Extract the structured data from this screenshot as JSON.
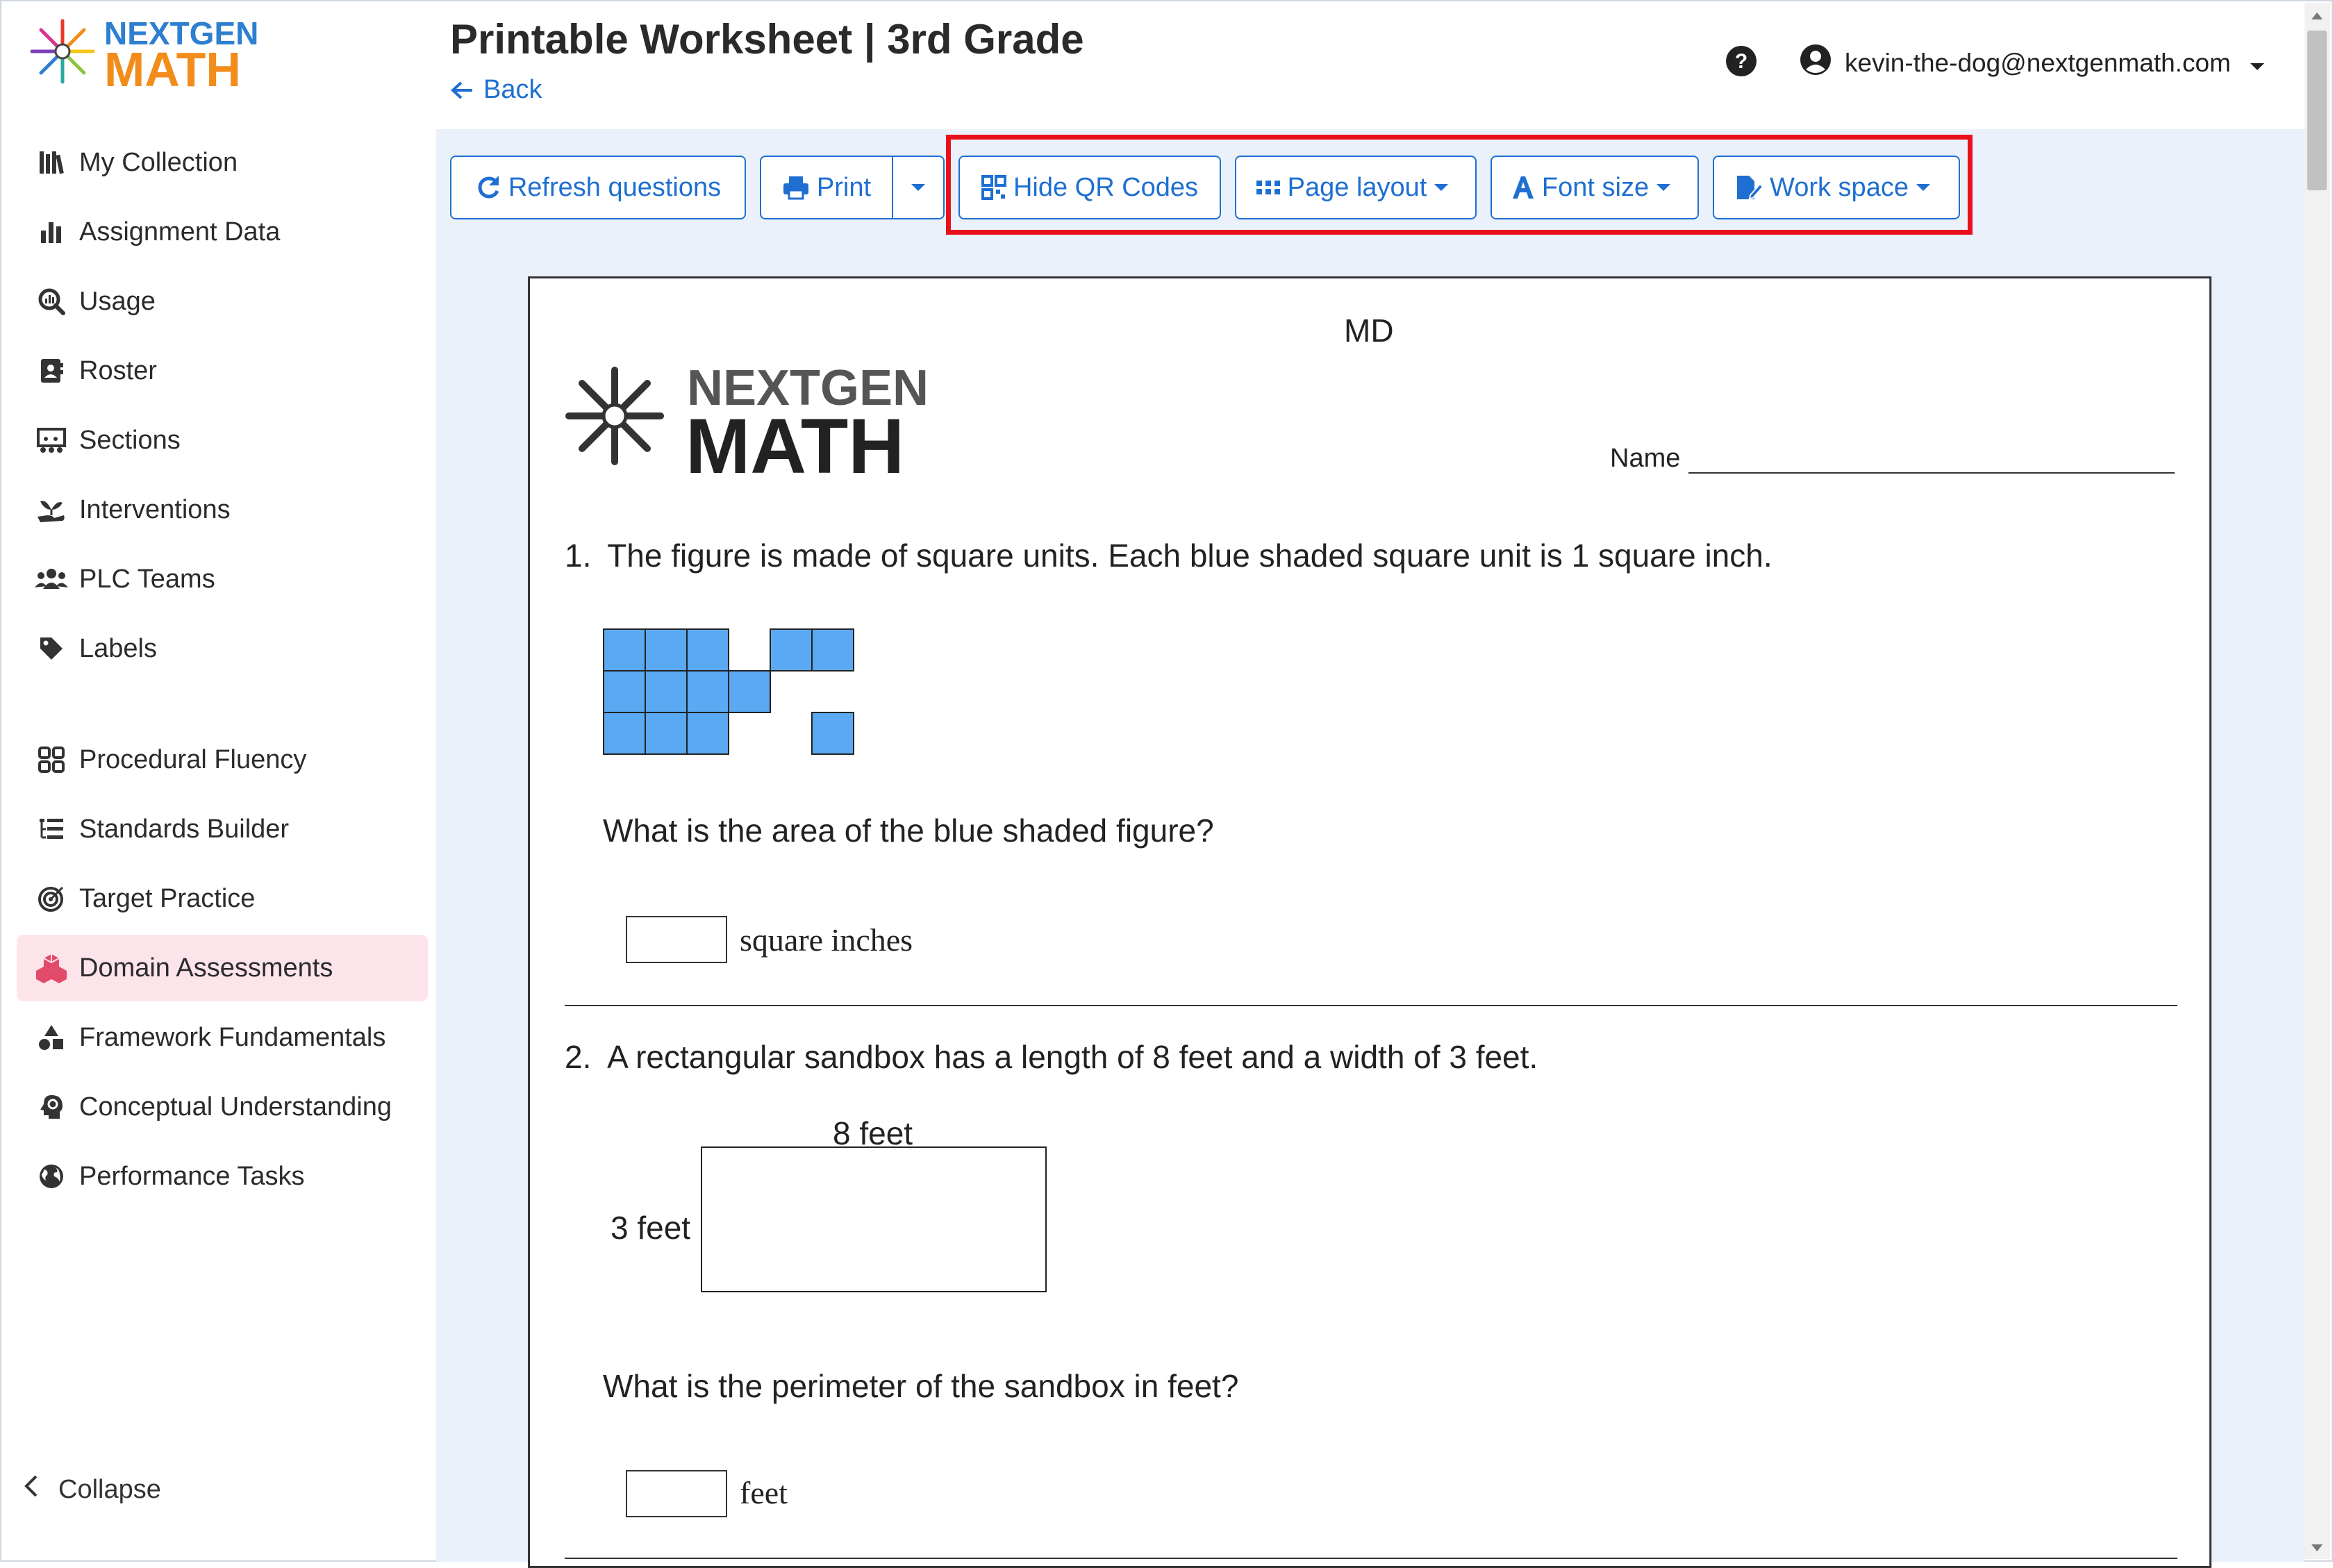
{
  "app": {
    "brand_top": "NEXTGEN",
    "brand_bottom": "MATH"
  },
  "header": {
    "title": "Printable Worksheet | 3rd Grade",
    "back_label": "Back",
    "user_email": "kevin-the-dog@nextgenmath.com"
  },
  "sidebar": {
    "items": [
      {
        "label": "My Collection",
        "icon": "books-icon"
      },
      {
        "label": "Assignment Data",
        "icon": "bar-chart-icon"
      },
      {
        "label": "Usage",
        "icon": "search-chart-icon"
      },
      {
        "label": "Roster",
        "icon": "contact-book-icon"
      },
      {
        "label": "Sections",
        "icon": "chalkboard-icon"
      },
      {
        "label": "Interventions",
        "icon": "hand-seedling-icon"
      },
      {
        "label": "PLC Teams",
        "icon": "users-icon"
      },
      {
        "label": "Labels",
        "icon": "tag-icon"
      },
      {
        "label": "Procedural Fluency",
        "icon": "grid-icon"
      },
      {
        "label": "Standards Builder",
        "icon": "list-tree-icon"
      },
      {
        "label": "Target Practice",
        "icon": "target-icon"
      },
      {
        "label": "Domain Assessments",
        "icon": "cubes-icon"
      },
      {
        "label": "Framework Fundamentals",
        "icon": "shapes-icon"
      },
      {
        "label": "Conceptual Understanding",
        "icon": "head-gear-icon"
      },
      {
        "label": "Performance Tasks",
        "icon": "globe-icon"
      }
    ],
    "active_index": 11,
    "collapse_label": "Collapse"
  },
  "toolbar": {
    "refresh_label": "Refresh questions",
    "print_label": "Print",
    "hide_qr_label": "Hide QR Codes",
    "page_layout_label": "Page layout",
    "font_size_label": "Font size",
    "work_space_label": "Work space"
  },
  "worksheet": {
    "code": "MD",
    "logo_top": "NEXTGEN",
    "logo_bottom": "MATH",
    "name_label": "Name",
    "questions": [
      {
        "number": "1.",
        "text": "The figure is made of square units. Each blue shaded square unit is 1 square inch.",
        "prompt": "What is the area of the blue shaded figure?",
        "answer_unit": "square inches"
      },
      {
        "number": "2.",
        "text": "A rectangular sandbox has a length of 8 feet and a width of 3 feet.",
        "length_label": "8 feet",
        "width_label": "3 feet",
        "prompt": "What is the perimeter of the sandbox in feet?",
        "answer_unit": "feet"
      }
    ]
  },
  "colors": {
    "accent": "#1e6fd1",
    "highlight": "#e8111b",
    "active_nav_bg": "#fde4ea",
    "square_fill": "#5aa9f2",
    "content_bg": "#eaf1fb"
  }
}
